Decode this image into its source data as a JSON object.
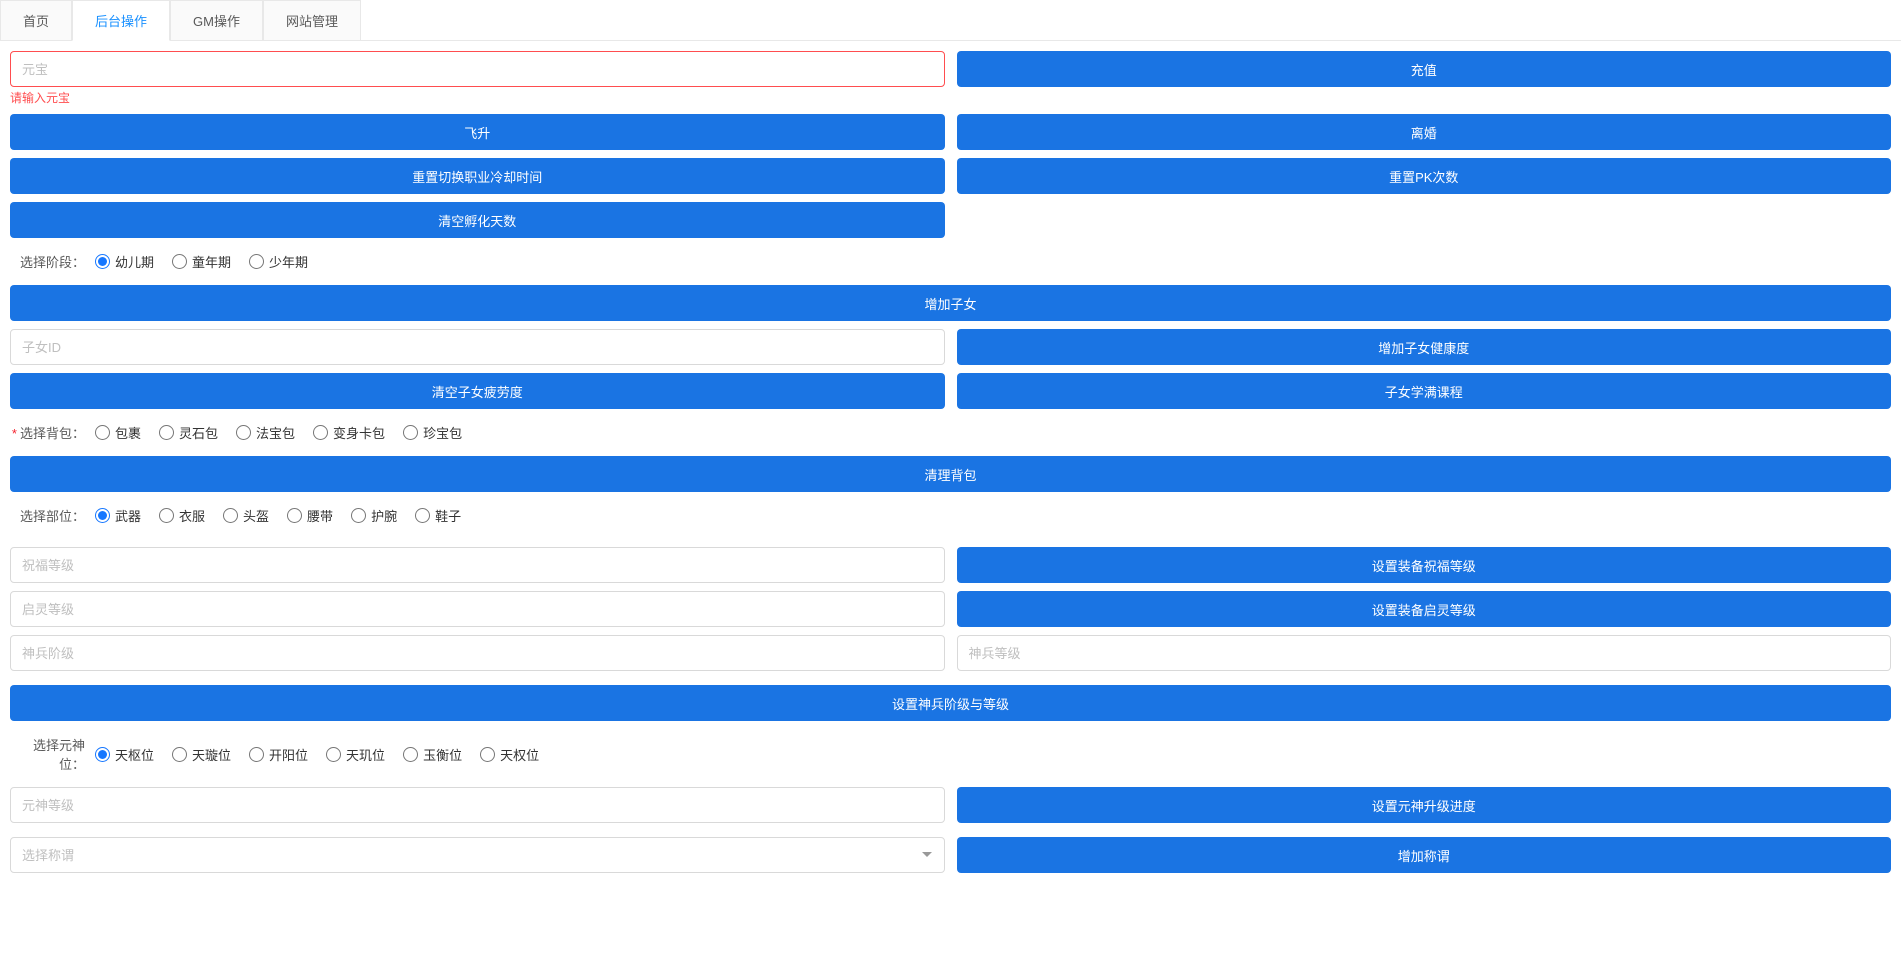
{
  "tabs": {
    "t1": "首页",
    "t2": "后台操作",
    "t3": "GM操作",
    "t4": "网站管理"
  },
  "yuanbao": {
    "placeholder": "元宝",
    "error": "请输入元宝"
  },
  "buttons": {
    "recharge": "充值",
    "ascend": "飞升",
    "divorce": "离婚",
    "resetJobCooldown": "重置切换职业冷却时间",
    "resetPK": "重置PK次数",
    "clearHatchDays": "清空孵化天数",
    "addChild": "增加子女",
    "addChildHealth": "增加子女健康度",
    "clearChildFatigue": "清空子女疲劳度",
    "childFullCourse": "子女学满课程",
    "clearBackpack": "清理背包",
    "setBlessLevel": "设置装备祝福等级",
    "setQilingLevel": "设置装备启灵等级",
    "setShenbingLevel": "设置神兵阶级与等级",
    "setYuanshenProgress": "设置元神升级进度",
    "addTitle": "增加称谓"
  },
  "labels": {
    "selectStage": "选择阶段：",
    "selectBackpack": "选择背包：",
    "selectPart": "选择部位：",
    "selectYuanshen": "选择元神位："
  },
  "stageOptions": {
    "o1": "幼儿期",
    "o2": "童年期",
    "o3": "少年期"
  },
  "backpackOptions": {
    "o1": "包裹",
    "o2": "灵石包",
    "o3": "法宝包",
    "o4": "变身卡包",
    "o5": "珍宝包"
  },
  "partOptions": {
    "o1": "武器",
    "o2": "衣服",
    "o3": "头盔",
    "o4": "腰带",
    "o5": "护腕",
    "o6": "鞋子"
  },
  "yuanshenOptions": {
    "o1": "天枢位",
    "o2": "天璇位",
    "o3": "开阳位",
    "o4": "天玑位",
    "o5": "玉衡位",
    "o6": "天权位"
  },
  "placeholders": {
    "childId": "子女ID",
    "blessLevel": "祝福等级",
    "qilingLevel": "启灵等级",
    "shenbingStage": "神兵阶级",
    "shenbingLevel": "神兵等级",
    "yuanshenLevel": "元神等级",
    "selectTitle": "选择称谓"
  }
}
